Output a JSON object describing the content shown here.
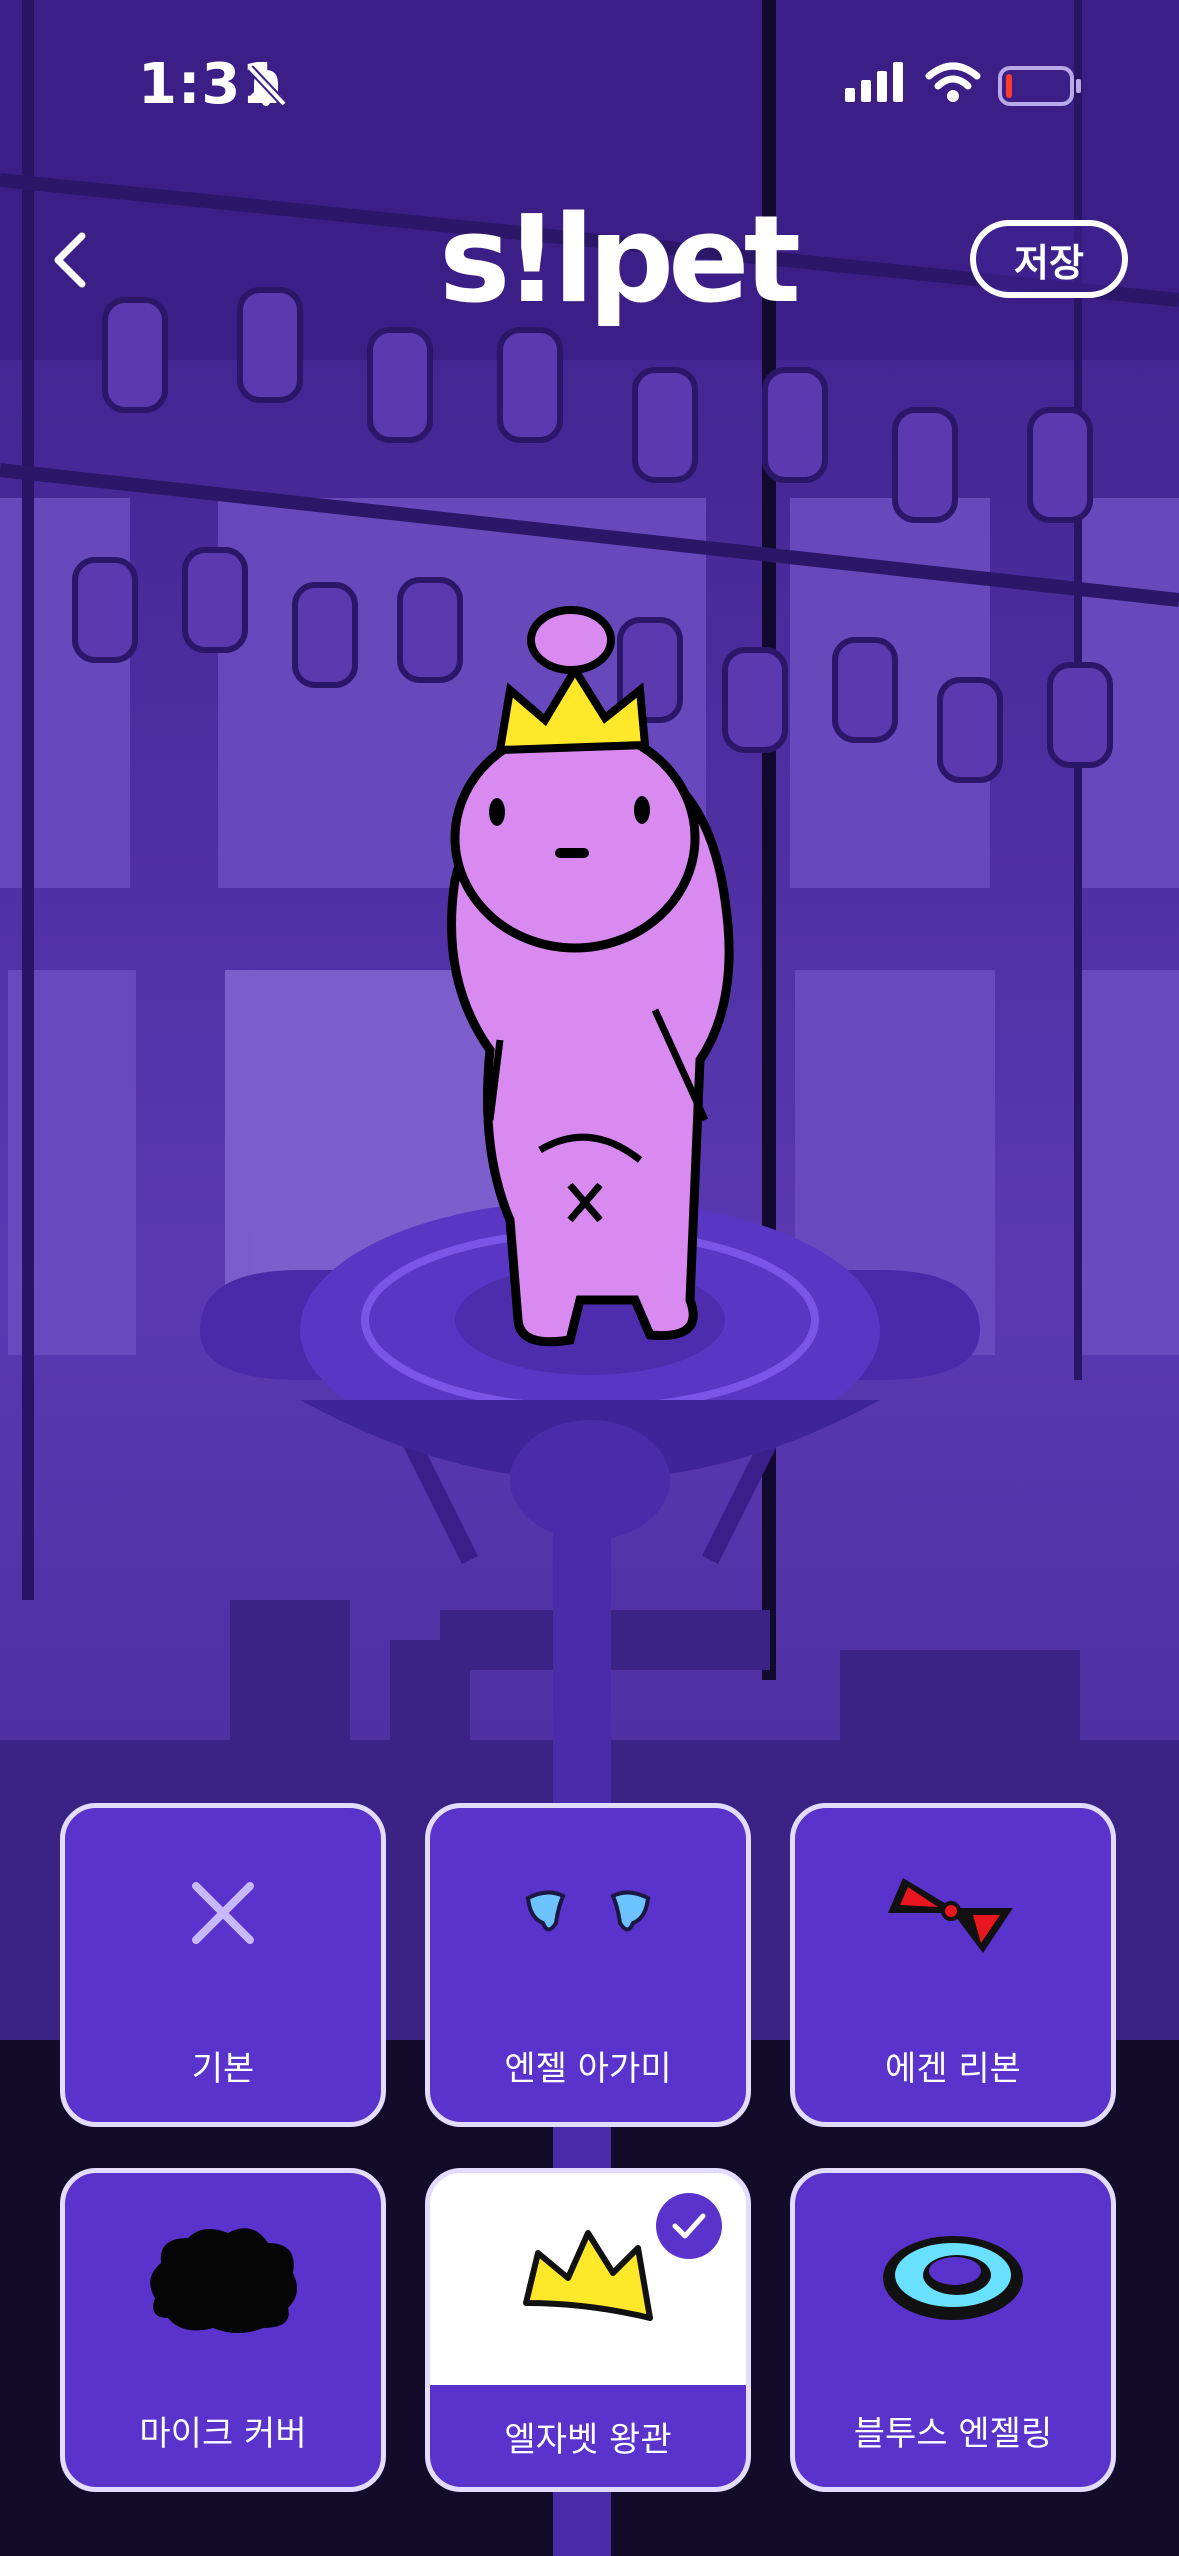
{
  "status_bar": {
    "time": "1:31",
    "icons": [
      "bell-muted-icon",
      "cellular-signal-icon",
      "wifi-icon",
      "battery-low-icon"
    ]
  },
  "header": {
    "logo": "s!lpet",
    "save_label": "저장",
    "back_icon": "chevron-left-icon"
  },
  "character": {
    "accessory": "엘자벳 왕관"
  },
  "items": [
    {
      "label": "기본",
      "icon": "x-icon",
      "selected": false
    },
    {
      "label": "엔젤 아가미",
      "icon": "angel-gills-icon",
      "selected": false
    },
    {
      "label": "에겐 리본",
      "icon": "red-ribbon-icon",
      "selected": false
    },
    {
      "label": "마이크 커버",
      "icon": "mic-cover-icon",
      "selected": false
    },
    {
      "label": "엘자벳 왕관",
      "icon": "crown-icon",
      "selected": true
    },
    {
      "label": "블투스 엔젤링",
      "icon": "halo-ring-icon",
      "selected": false
    }
  ],
  "colors": {
    "accent": "#5a33cc",
    "background": "#4a2a9e",
    "character": "#d98af0",
    "crown": "#ffe82a"
  }
}
